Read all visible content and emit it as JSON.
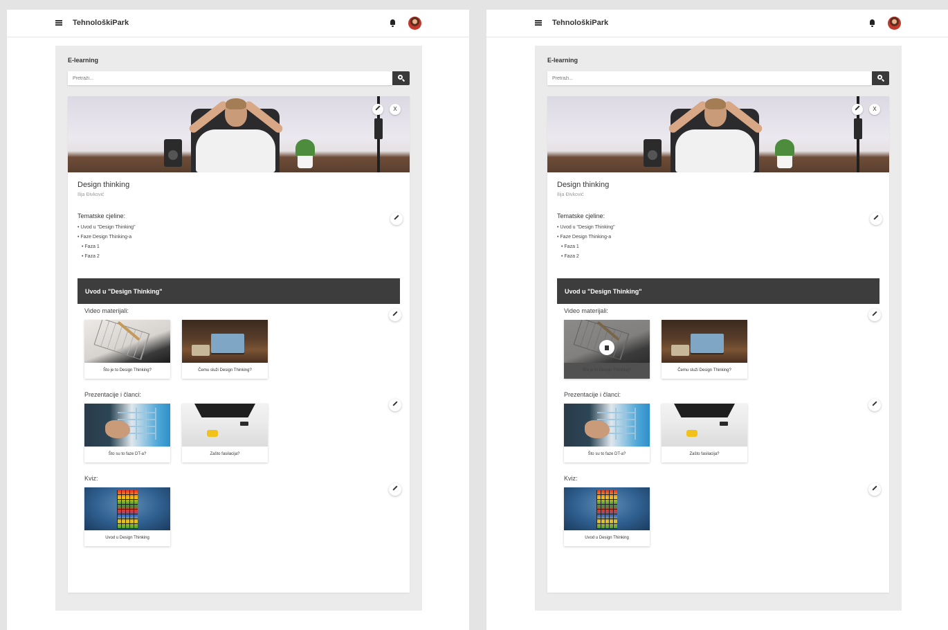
{
  "app": {
    "brand": "TehnološkiPark"
  },
  "page": {
    "section_title": "E-learning",
    "search_placeholder": "Pretraži..."
  },
  "course": {
    "title": "Design thinking",
    "author": "Ilija Đivković",
    "hero_edit_icon": "pencil-icon",
    "hero_close_label": "X",
    "topics_heading": "Tematske cjeline:",
    "topics": [
      "• Uvod u \"Design Thinking\"",
      "• Faze Design Thinking-a",
      "• Faza 1",
      "• Faza 2"
    ]
  },
  "module": {
    "title": "Uvod u \"Design Thinking\"",
    "groups": [
      {
        "label": "Video materijali:",
        "items": [
          {
            "caption": "Što je to Design Thinking?",
            "thumb": "sketch-photo"
          },
          {
            "caption": "Čemu služi Design Thinking?",
            "thumb": "desk-photo"
          }
        ]
      },
      {
        "label": "Prezentacije i članci:",
        "items": [
          {
            "caption": "Što su to faze DT-a?",
            "thumb": "whiteboard-photo"
          },
          {
            "caption": "Zašto fasilacija?",
            "thumb": "topdesk-photo"
          }
        ]
      },
      {
        "label": "Kviz:",
        "items": [
          {
            "caption": "Uvod u Design Thinking",
            "thumb": "rubik-cube-photo"
          }
        ]
      }
    ]
  },
  "states": {
    "left": "default",
    "right": "first-video-hovered"
  },
  "colors": {
    "background": "#e4e4e4",
    "module_bar": "#3d3d3d",
    "search_button": "#3a3a3a",
    "avatar": "#c0392b"
  }
}
